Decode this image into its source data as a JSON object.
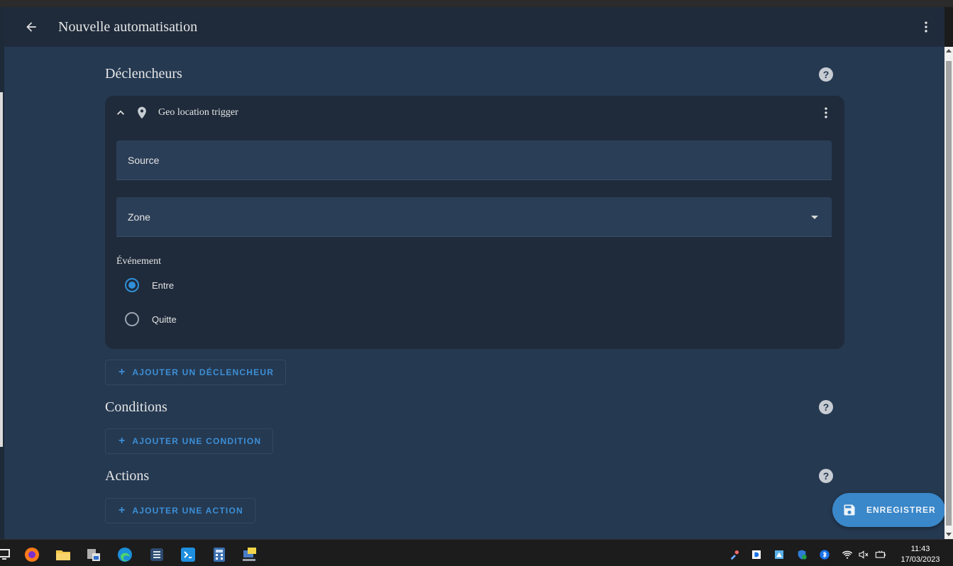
{
  "app": {
    "title": "Nouvelle automatisation"
  },
  "sections": {
    "triggers": {
      "title": "Déclencheurs",
      "add_label": "AJOUTER UN DÉCLENCHEUR"
    },
    "conditions": {
      "title": "Conditions",
      "add_label": "AJOUTER UNE CONDITION"
    },
    "actions": {
      "title": "Actions",
      "add_label": "AJOUTER UNE ACTION"
    }
  },
  "trigger_card": {
    "title": "Geo location trigger",
    "icon": "map-marker-icon",
    "fields": {
      "source_label": "Source",
      "zone_label": "Zone"
    },
    "event": {
      "label": "Événement",
      "options": [
        {
          "label": "Entre",
          "checked": true
        },
        {
          "label": "Quitte",
          "checked": false
        }
      ]
    }
  },
  "fab": {
    "label": "ENREGISTRER"
  },
  "taskbar": {
    "time": "11:43",
    "date": "17/03/2023"
  },
  "colors": {
    "background": "#253951",
    "appbar": "#1f2b3b",
    "card": "#1f2b3b",
    "accent": "#3d8fd6",
    "fab": "#3a87c9"
  }
}
